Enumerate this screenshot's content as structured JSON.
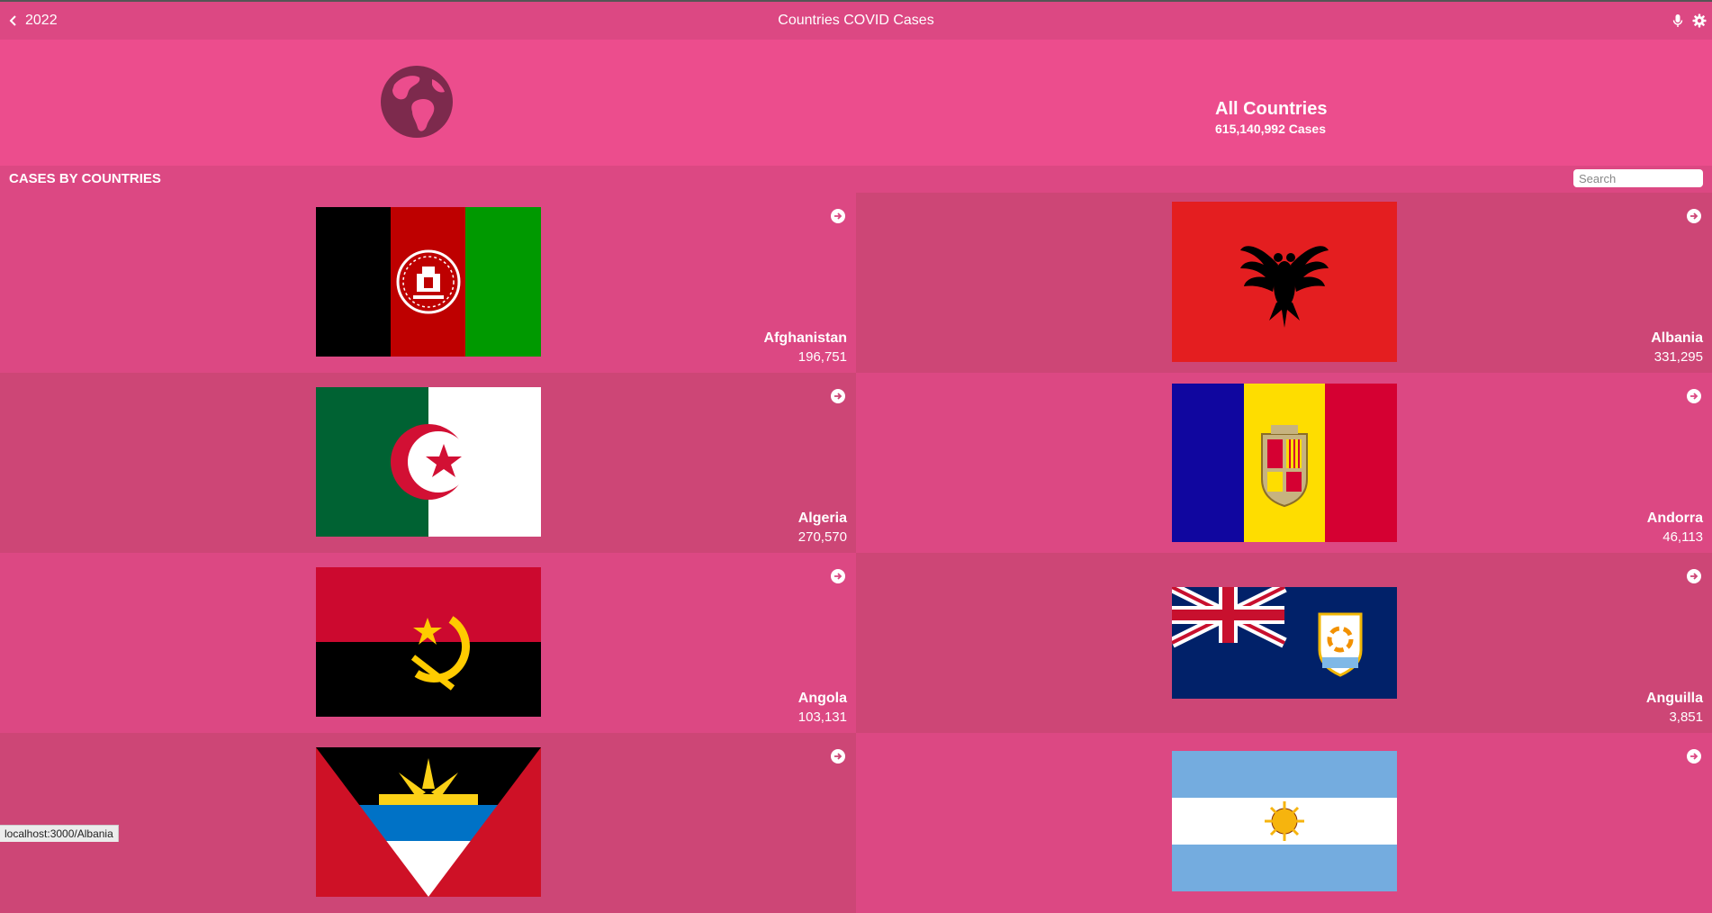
{
  "header": {
    "back_label": "2022",
    "title": "Countries COVID Cases"
  },
  "hero": {
    "name": "All Countries",
    "cases": "615,140,992 Cases"
  },
  "section": {
    "title": "CASES BY COUNTRIES",
    "search_placeholder": "Search"
  },
  "countries": [
    {
      "name": "Afghanistan",
      "cases": "196,751"
    },
    {
      "name": "Albania",
      "cases": "331,295"
    },
    {
      "name": "Algeria",
      "cases": "270,570"
    },
    {
      "name": "Andorra",
      "cases": "46,113"
    },
    {
      "name": "Angola",
      "cases": "103,131"
    },
    {
      "name": "Anguilla",
      "cases": "3,851"
    }
  ],
  "status_url": "localhost:3000/Albania",
  "colors": {
    "header": "#dc4883",
    "hero": "#ec4d8d",
    "card_light": "#dc4883",
    "card_dark": "#cd4676",
    "globe": "#7d2a4d"
  },
  "icons": [
    "chevron-left-icon",
    "microphone-icon",
    "gear-icon",
    "globe-icon",
    "arrow-right-circle-icon"
  ]
}
